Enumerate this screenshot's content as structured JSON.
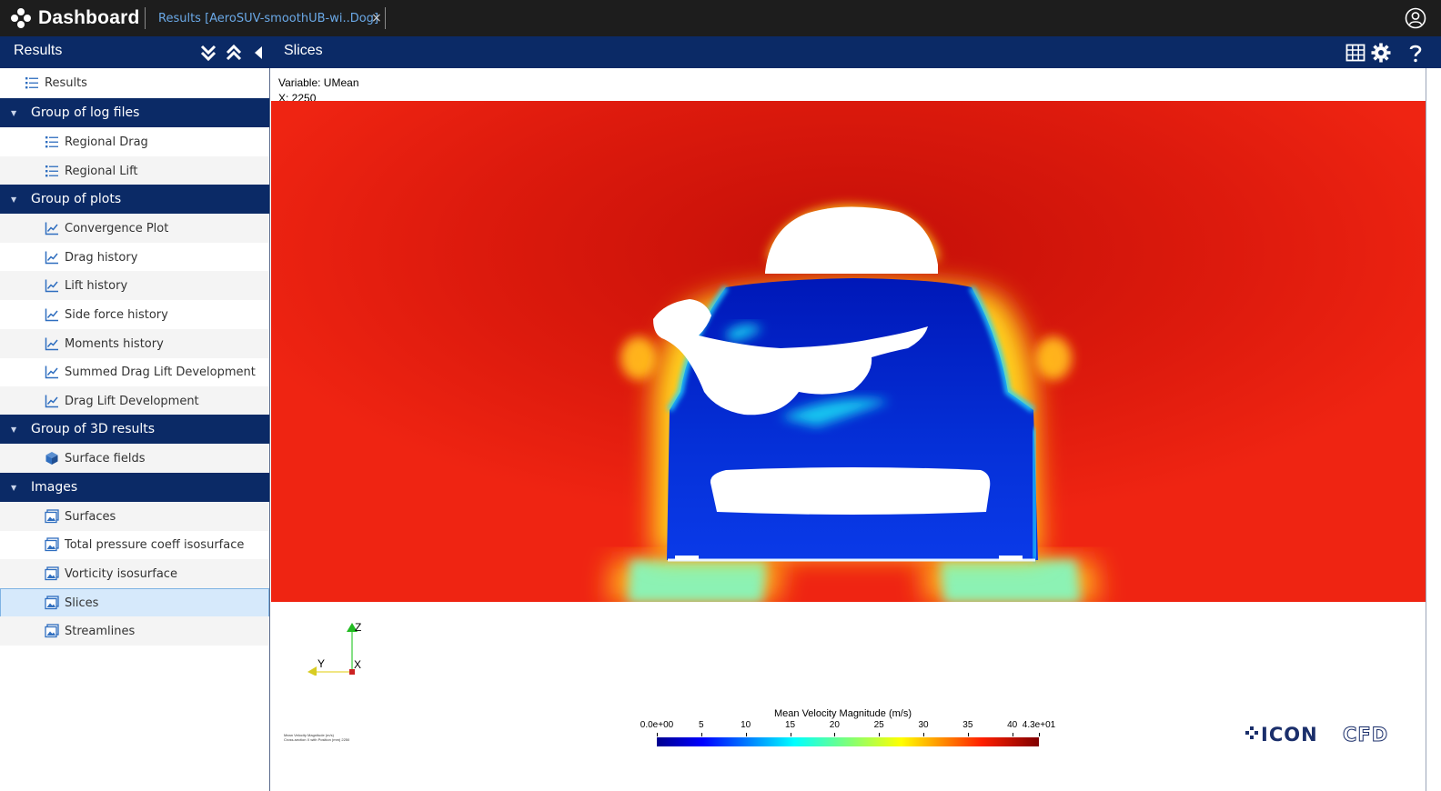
{
  "app": {
    "title": "Dashboard"
  },
  "tab": {
    "label": "Results [AeroSUV-smoothUB-wi..Dog]",
    "close": "×"
  },
  "left_panel": {
    "title": "Results"
  },
  "main_panel": {
    "title": "Slices"
  },
  "sidebar": {
    "root": {
      "label": "Results"
    },
    "groups": [
      {
        "label": "Group of log files",
        "items": [
          {
            "label": "Regional Drag",
            "icon": "list-icon"
          },
          {
            "label": "Regional Lift",
            "icon": "list-icon"
          }
        ]
      },
      {
        "label": "Group of plots",
        "items": [
          {
            "label": "Convergence Plot",
            "icon": "line-chart-icon"
          },
          {
            "label": "Drag history",
            "icon": "line-chart-icon"
          },
          {
            "label": "Lift history",
            "icon": "line-chart-icon"
          },
          {
            "label": "Side force history",
            "icon": "line-chart-icon"
          },
          {
            "label": "Moments history",
            "icon": "line-chart-icon"
          },
          {
            "label": "Summed Drag Lift Development",
            "icon": "line-chart-icon"
          },
          {
            "label": "Drag Lift Development",
            "icon": "line-chart-icon"
          }
        ]
      },
      {
        "label": "Group of 3D results",
        "items": [
          {
            "label": "Surface fields",
            "icon": "cube-icon"
          }
        ]
      },
      {
        "label": "Images",
        "items": [
          {
            "label": "Surfaces",
            "icon": "image-icon"
          },
          {
            "label": "Total pressure coeff isosurface",
            "icon": "image-icon"
          },
          {
            "label": "Vorticity isosurface",
            "icon": "image-icon"
          },
          {
            "label": "Slices",
            "icon": "image-icon",
            "selected": true
          },
          {
            "label": "Streamlines",
            "icon": "image-icon"
          }
        ]
      }
    ]
  },
  "viewer": {
    "variable": "Variable: UMean",
    "position": "X: 2250",
    "axes": {
      "z": "Z",
      "y": "Y",
      "x": "X"
    },
    "colorbar": {
      "title": "Mean Velocity Magnitude (m/s)",
      "ticks": [
        "0.0e+00",
        "5",
        "10",
        "15",
        "20",
        "25",
        "30",
        "35",
        "40",
        "4.3e+01"
      ],
      "min": 0,
      "max": 43
    },
    "tiny_note_1": "Mean Velocity Magnitude (m/s)",
    "tiny_note_2": "Cross-section X with Position (mm) 2250",
    "logo": "ICONCFD"
  },
  "colors": {
    "topbar": "#1d1d1d",
    "header_blue": "#0b2a66",
    "accent": "#2f6ebf",
    "selected": "#d6e9fb"
  }
}
